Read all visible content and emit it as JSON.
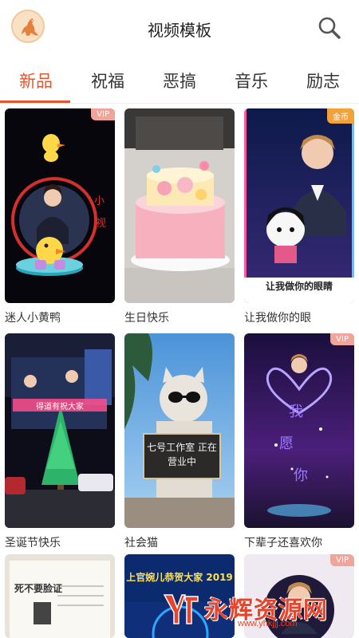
{
  "header": {
    "title": "视频模板",
    "avatar_icon": "kangaroo-logo-icon",
    "search_icon": "search-icon"
  },
  "tabs": [
    {
      "label": "新品",
      "active": true
    },
    {
      "label": "祝福",
      "active": false
    },
    {
      "label": "恶搞",
      "active": false
    },
    {
      "label": "音乐",
      "active": false
    },
    {
      "label": "励志",
      "active": false
    }
  ],
  "templates": [
    {
      "name": "迷人小黄鸭",
      "badge": "VIP"
    },
    {
      "name": "生日快乐",
      "badge": ""
    },
    {
      "name": "让我做你的眼",
      "badge": "金币",
      "overlay_text": "让我做你的眼睛"
    },
    {
      "name": "圣诞节快乐",
      "badge": "",
      "overlay_text": "得道有祝大家"
    },
    {
      "name": "社会猫",
      "badge": "",
      "overlay_text": "七号工作室 正在营业中"
    },
    {
      "name": "下辈子还喜欢你",
      "badge": "VIP"
    },
    {
      "name": "",
      "badge": "",
      "overlay_text": "死不要脸证"
    },
    {
      "name": "",
      "badge": "",
      "overlay_text": "上官婉儿恭贺大家 2019"
    },
    {
      "name": "",
      "badge": "VIP"
    }
  ],
  "watermark": {
    "text": "永辉资源网",
    "url": "www.yhkjjj.com"
  },
  "colors": {
    "accent": "#e4572e",
    "vip_badge": "#f0a49a",
    "gold_badge": "#f3a23a"
  }
}
